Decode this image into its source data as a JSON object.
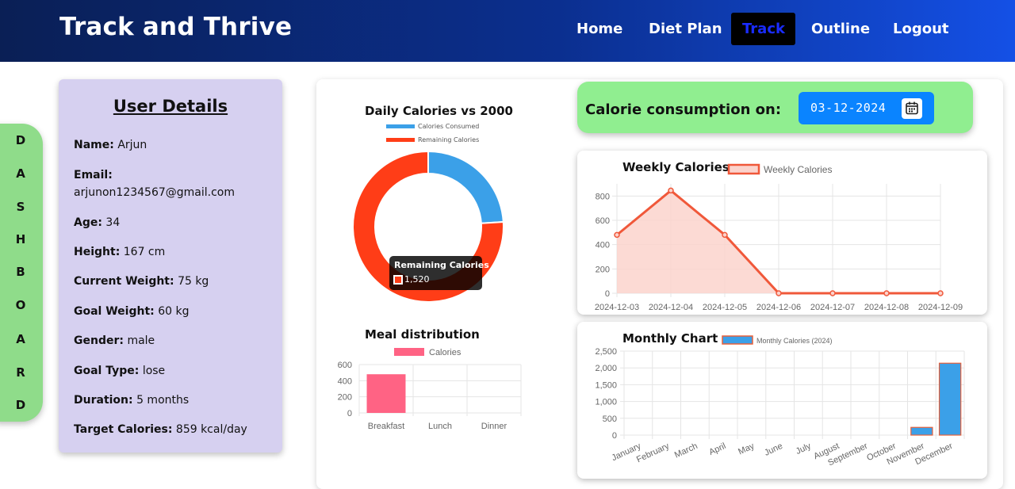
{
  "header": {
    "brand": "Track and Thrive",
    "nav": [
      {
        "label": "Home",
        "active": false
      },
      {
        "label": "Diet Plan",
        "active": false
      },
      {
        "label": "Track",
        "active": true
      },
      {
        "label": "Outline",
        "active": false
      },
      {
        "label": "Logout",
        "active": false
      }
    ]
  },
  "sidebar": {
    "letters": [
      "D",
      "A",
      "S",
      "H",
      "B",
      "O",
      "A",
      "R",
      "D"
    ]
  },
  "user": {
    "title": "User Details",
    "fields": [
      {
        "label": "Name:",
        "value": "Arjun"
      },
      {
        "label": "Email:",
        "value": "arjunon1234567@gmail.com"
      },
      {
        "label": "Age:",
        "value": "34"
      },
      {
        "label": "Height:",
        "value": "167 cm"
      },
      {
        "label": "Current Weight:",
        "value": "75 kg"
      },
      {
        "label": "Goal Weight:",
        "value": "60 kg"
      },
      {
        "label": "Gender:",
        "value": "male"
      },
      {
        "label": "Goal Type:",
        "value": "lose"
      },
      {
        "label": "Duration:",
        "value": "5 months"
      },
      {
        "label": "Target Calories:",
        "value": "859 kcal/day"
      }
    ]
  },
  "consumption": {
    "label": "Calorie consumption on:",
    "date": "03-12-2024",
    "calendar_icon": "calendar-icon"
  },
  "colors": {
    "blue": "#3ba0e8",
    "red_orange": "#ff3d17",
    "line": "#f0583a",
    "line_fill": "#fbd3cc",
    "pink": "#ff6384",
    "bar_blue": "#3ba0e8",
    "bar_border": "#e8603a"
  },
  "chart_data": [
    {
      "id": "daily",
      "type": "pie",
      "title": "Daily Calories vs 2000",
      "labels": [
        "Calories Consumed",
        "Remaining Calories"
      ],
      "values": [
        480,
        1520
      ],
      "tooltip": {
        "title": "Remaining Calories",
        "value": "1,520"
      }
    },
    {
      "id": "meal",
      "type": "bar",
      "title": "Meal distribution",
      "categories": [
        "Breakfast",
        "Lunch",
        "Dinner"
      ],
      "series": [
        {
          "name": "Calories",
          "values": [
            480,
            0,
            0
          ]
        }
      ],
      "ylim": [
        0,
        600
      ],
      "yticks": [
        "0",
        "200",
        "400",
        "600"
      ]
    },
    {
      "id": "weekly",
      "type": "area",
      "title": "Weekly Calories",
      "categories": [
        "2024-12-03",
        "2024-12-04",
        "2024-12-05",
        "2024-12-06",
        "2024-12-07",
        "2024-12-08",
        "2024-12-09"
      ],
      "series": [
        {
          "name": "Weekly Calories",
          "values": [
            480,
            845,
            480,
            0,
            0,
            0,
            0
          ]
        }
      ],
      "ylim": [
        0,
        900
      ],
      "yticks": [
        "0",
        "200",
        "400",
        "600",
        "800"
      ]
    },
    {
      "id": "monthly",
      "type": "bar",
      "title": "Monthly Chart",
      "categories": [
        "January",
        "February",
        "March",
        "April",
        "May",
        "June",
        "July",
        "August",
        "September",
        "October",
        "November",
        "December"
      ],
      "series": [
        {
          "name": "Monthly Calories (2024)",
          "values": [
            0,
            0,
            0,
            0,
            0,
            0,
            0,
            0,
            0,
            0,
            230,
            2140
          ]
        }
      ],
      "ylim": [
        0,
        2500
      ],
      "yticks": [
        "0",
        "500",
        "1,000",
        "1,500",
        "2,000",
        "2,500"
      ]
    }
  ]
}
